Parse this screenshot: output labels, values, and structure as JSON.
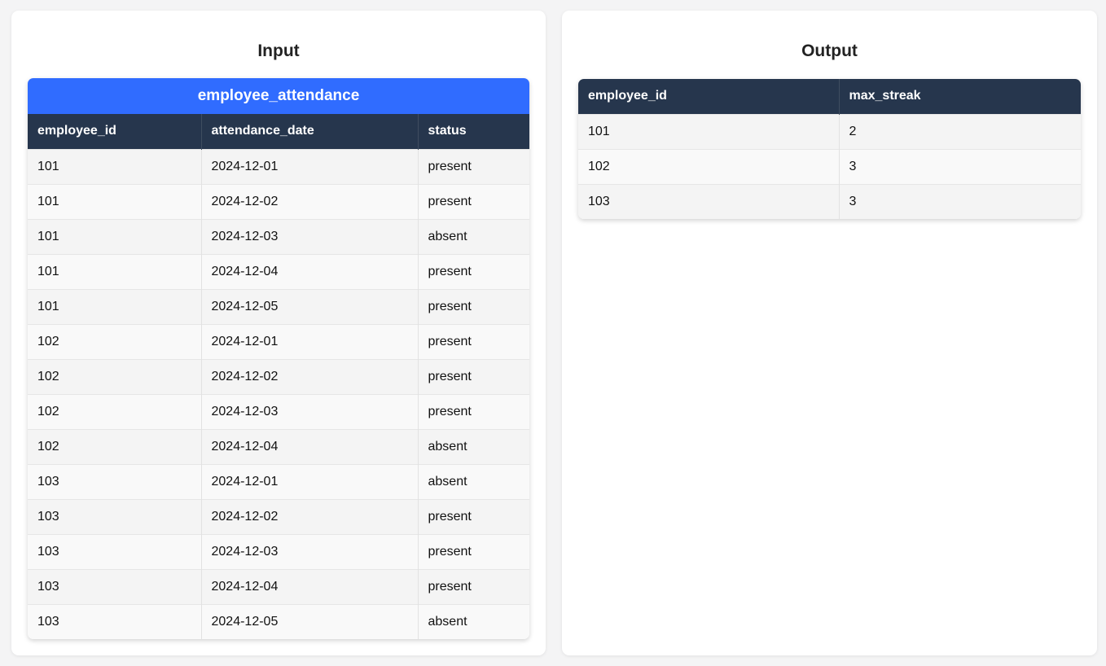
{
  "colors": {
    "caption_bg": "#306cff",
    "header_bg": "#26364d"
  },
  "input": {
    "title": "Input",
    "table_name": "employee_attendance",
    "columns": [
      "employee_id",
      "attendance_date",
      "status"
    ],
    "rows": [
      [
        "101",
        "2024-12-01",
        "present"
      ],
      [
        "101",
        "2024-12-02",
        "present"
      ],
      [
        "101",
        "2024-12-03",
        "absent"
      ],
      [
        "101",
        "2024-12-04",
        "present"
      ],
      [
        "101",
        "2024-12-05",
        "present"
      ],
      [
        "102",
        "2024-12-01",
        "present"
      ],
      [
        "102",
        "2024-12-02",
        "present"
      ],
      [
        "102",
        "2024-12-03",
        "present"
      ],
      [
        "102",
        "2024-12-04",
        "absent"
      ],
      [
        "103",
        "2024-12-01",
        "absent"
      ],
      [
        "103",
        "2024-12-02",
        "present"
      ],
      [
        "103",
        "2024-12-03",
        "present"
      ],
      [
        "103",
        "2024-12-04",
        "present"
      ],
      [
        "103",
        "2024-12-05",
        "absent"
      ]
    ]
  },
  "output": {
    "title": "Output",
    "columns": [
      "employee_id",
      "max_streak"
    ],
    "rows": [
      [
        "101",
        "2"
      ],
      [
        "102",
        "3"
      ],
      [
        "103",
        "3"
      ]
    ]
  }
}
